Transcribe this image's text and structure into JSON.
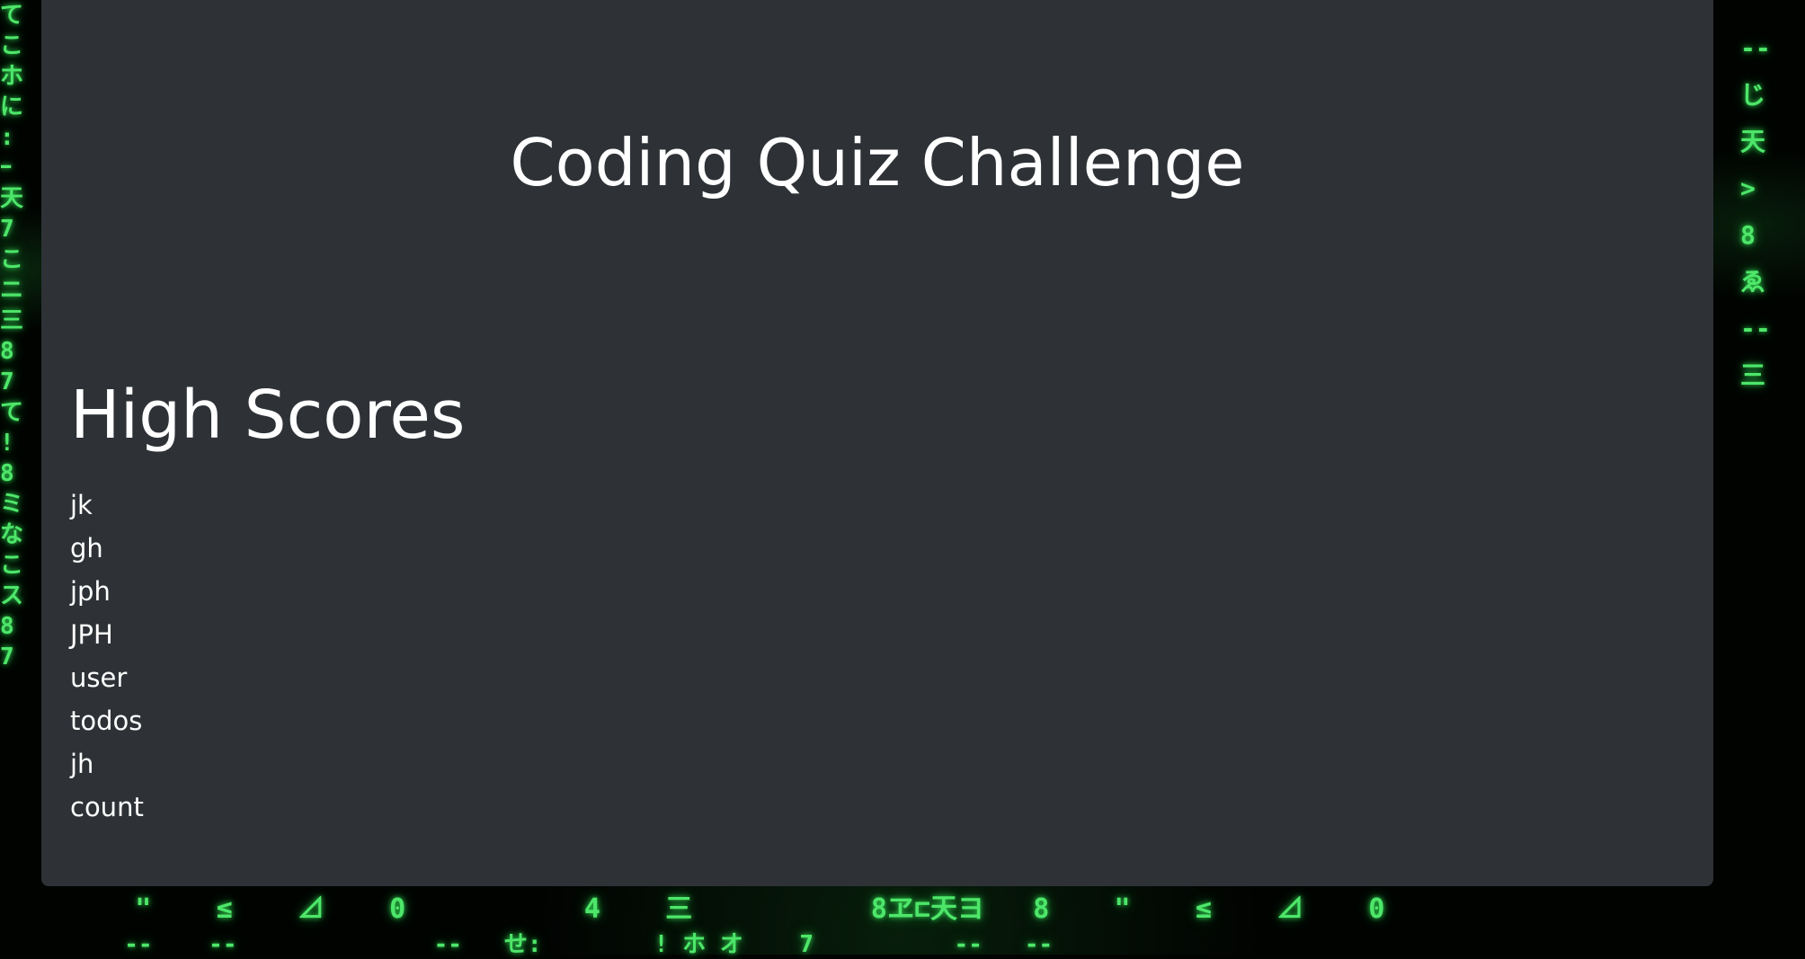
{
  "app": {
    "title": "Coding Quiz Challenge"
  },
  "high_scores": {
    "heading": "High Scores",
    "entries": [
      "jk",
      "gh",
      "jph",
      "JPH",
      "user",
      "todos",
      "jh",
      "count"
    ]
  },
  "background": {
    "left_glyphs": [
      "て",
      "こ",
      "ホ",
      "に",
      ":",
      "ｰ",
      "天",
      "7",
      "こ",
      "ニ",
      "三",
      "8",
      "7",
      "て",
      "!",
      "8",
      "ミ",
      "な",
      "こ",
      "ス",
      "8",
      "7"
    ],
    "right_glyphs": [
      "--",
      "じ",
      "天",
      ">",
      "8",
      "ゑ",
      "--",
      "三"
    ],
    "bottom_glyphs": "     \"    ≤    ⊿    0           4    三           8ヱ⊏天ヨ   8    \"    ≤    ⊿    0",
    "bottom_glyphs_2": "     --    --              --   せ:        ! ホ オ    7          --   --",
    "accent_color": "#4ee66a"
  },
  "colors": {
    "card_bg": "#2e3237",
    "text": "#ffffff"
  }
}
